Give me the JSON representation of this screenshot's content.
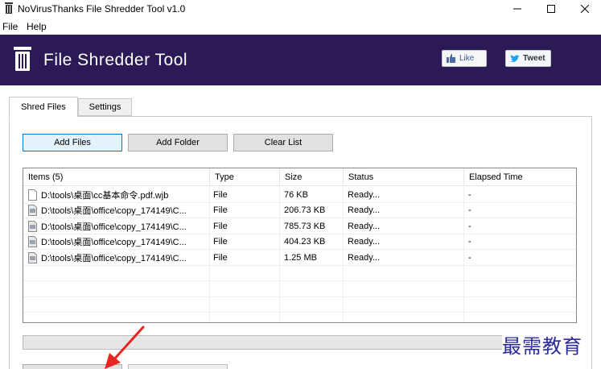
{
  "window": {
    "title": "NoVirusThanks File Shredder Tool v1.0",
    "controls": [
      "minimize-icon",
      "maximize-icon",
      "close-icon"
    ]
  },
  "menu": {
    "file": "File",
    "help": "Help"
  },
  "banner": {
    "title": "File Shredder Tool",
    "like": "Like",
    "tweet": "Tweet",
    "background_color": "#2b1a55"
  },
  "tabs": [
    {
      "label": "Shred Files",
      "active": true
    },
    {
      "label": "Settings",
      "active": false
    }
  ],
  "toolbar": {
    "add_files": "Add Files",
    "add_folder": "Add Folder",
    "clear_list": "Clear List"
  },
  "table": {
    "columns": [
      "Items (5)",
      "Type",
      "Size",
      "Status",
      "Elapsed Time"
    ],
    "rows": [
      {
        "name": "D:\\tools\\桌面\\cc基本命令.pdf.wjb",
        "type": "File",
        "size": "76 KB",
        "status": "Ready...",
        "elapsed": "-"
      },
      {
        "name": "D:\\tools\\桌面\\office\\copy_174149\\C...",
        "type": "File",
        "size": "206.73 KB",
        "status": "Ready...",
        "elapsed": "-"
      },
      {
        "name": "D:\\tools\\桌面\\office\\copy_174149\\C...",
        "type": "File",
        "size": "785.73 KB",
        "status": "Ready...",
        "elapsed": "-"
      },
      {
        "name": "D:\\tools\\桌面\\office\\copy_174149\\C...",
        "type": "File",
        "size": "404.23 KB",
        "status": "Ready...",
        "elapsed": "-"
      },
      {
        "name": "D:\\tools\\桌面\\office\\copy_174149\\C...",
        "type": "File",
        "size": "1.25 MB",
        "status": "Ready...",
        "elapsed": "-"
      }
    ]
  },
  "progress": {
    "value": 0
  },
  "watermark": "最需教育",
  "annotation_color": "#e8251f"
}
